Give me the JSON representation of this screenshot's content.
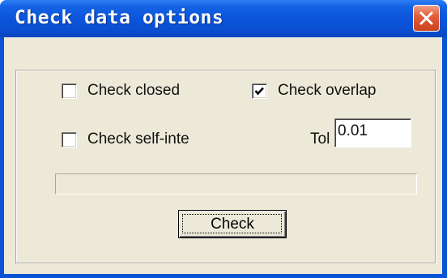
{
  "window": {
    "title": "Check data options"
  },
  "options": {
    "check_closed": {
      "label": "Check closed",
      "checked": false
    },
    "check_overlap": {
      "label": "Check overlap",
      "checked": true
    },
    "check_self_intersect": {
      "label": "Check self-inte",
      "checked": false
    }
  },
  "tolerance": {
    "label": "Tol",
    "value": "0.01"
  },
  "progress": {
    "value": 0
  },
  "actions": {
    "check_label": "Check"
  },
  "icons": {
    "close": "close-icon",
    "checkmark": "checkmark-icon"
  },
  "colors": {
    "titlebar": "#0a52d6",
    "close_button": "#d8502a",
    "dialog_background": "#ece9d8"
  }
}
